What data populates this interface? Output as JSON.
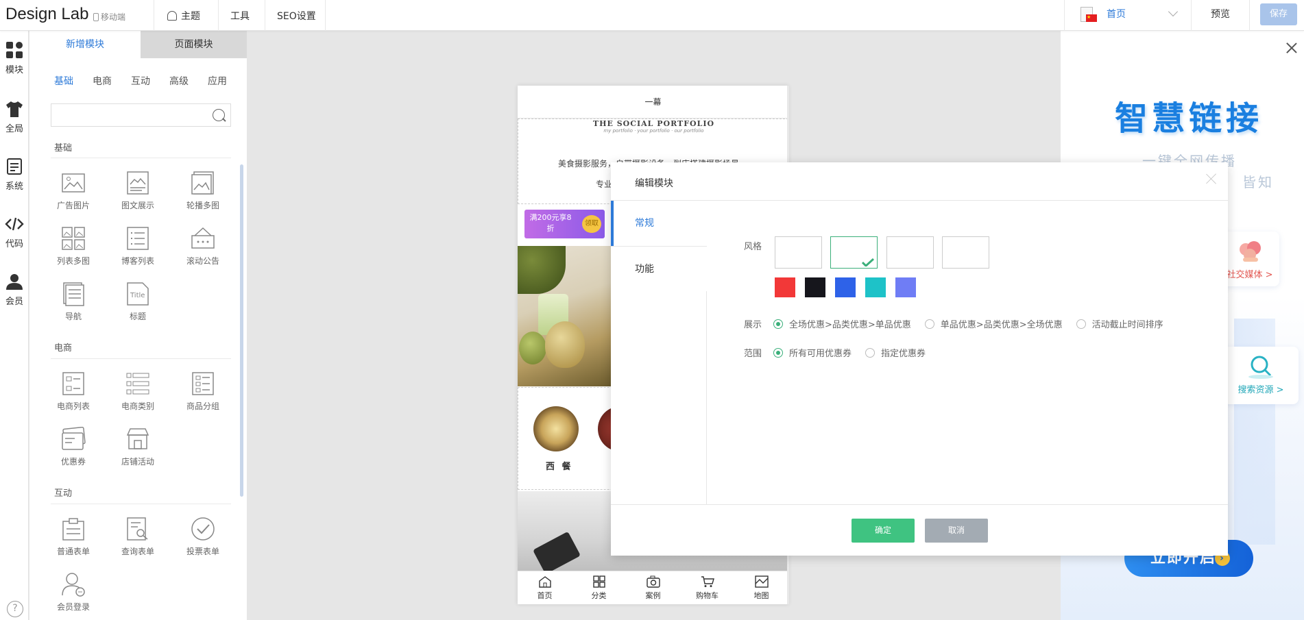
{
  "header": {
    "logo": "Design Lab",
    "mobile_label": "移动端",
    "menu": [
      "主题",
      "工具",
      "SEO设置"
    ],
    "page_select": "首页",
    "preview_label": "预览",
    "save_label": "保存"
  },
  "rail": {
    "items": [
      {
        "label": "模块",
        "icon": "grid-icon"
      },
      {
        "label": "全局",
        "icon": "shirt-icon"
      },
      {
        "label": "系统",
        "icon": "doc-icon"
      },
      {
        "label": "代码",
        "icon": "code-icon"
      },
      {
        "label": "会员",
        "icon": "user-icon"
      }
    ],
    "help": "?"
  },
  "panel": {
    "tabs": [
      "新增模块",
      "页面模块"
    ],
    "subtabs": [
      "基础",
      "电商",
      "互动",
      "高级",
      "应用"
    ],
    "search": {
      "placeholder": ""
    },
    "groups": [
      {
        "title": "基础",
        "items": [
          "广告图片",
          "图文展示",
          "轮播多图",
          "列表多图",
          "博客列表",
          "滚动公告",
          "导航",
          "标题"
        ]
      },
      {
        "title": "电商",
        "items": [
          "电商列表",
          "电商类别",
          "商品分组",
          "优惠券",
          "店铺活动"
        ]
      },
      {
        "title": "互动",
        "items": [
          "普通表单",
          "查询表单",
          "投票表单",
          "会员登录"
        ]
      }
    ]
  },
  "phone": {
    "header": "一幕",
    "brand": "THE SOCIAL PORTFOLIO",
    "brand_sub": "my portfolio · your portfolio · our portfolio",
    "line1": "美食摄影服务，自带摄影设备，到店搭建摄影场景",
    "line2": "专业",
    "coupon_text": "满200元享8折",
    "coupon_button": "领取",
    "dish_label": "西 餐",
    "nav": [
      "首页",
      "分类",
      "案例",
      "购物车",
      "地图"
    ]
  },
  "promo": {
    "title": "智慧链接",
    "sub1": "一键全网传播",
    "sub2": "皆知",
    "card1": "社交媒体 >",
    "card2": "搜索资源 >",
    "cta": "立即开启"
  },
  "modal": {
    "title": "编辑模块",
    "side_tabs": [
      "常规",
      "功能"
    ],
    "style_label": "风格",
    "colors": [
      "#f23838",
      "#16161c",
      "#2e62e8",
      "#1ec2c8",
      "#6f7df5"
    ],
    "display_label": "展示",
    "display_options": [
      "全场优惠>品类优惠>单品优惠",
      "单品优惠>品类优惠>全场优惠",
      "活动截止时间排序"
    ],
    "display_selected": 0,
    "range_label": "范围",
    "range_options": [
      "所有可用优惠券",
      "指定优惠券"
    ],
    "range_selected": 0,
    "ok_label": "确定",
    "cancel_label": "取消"
  }
}
